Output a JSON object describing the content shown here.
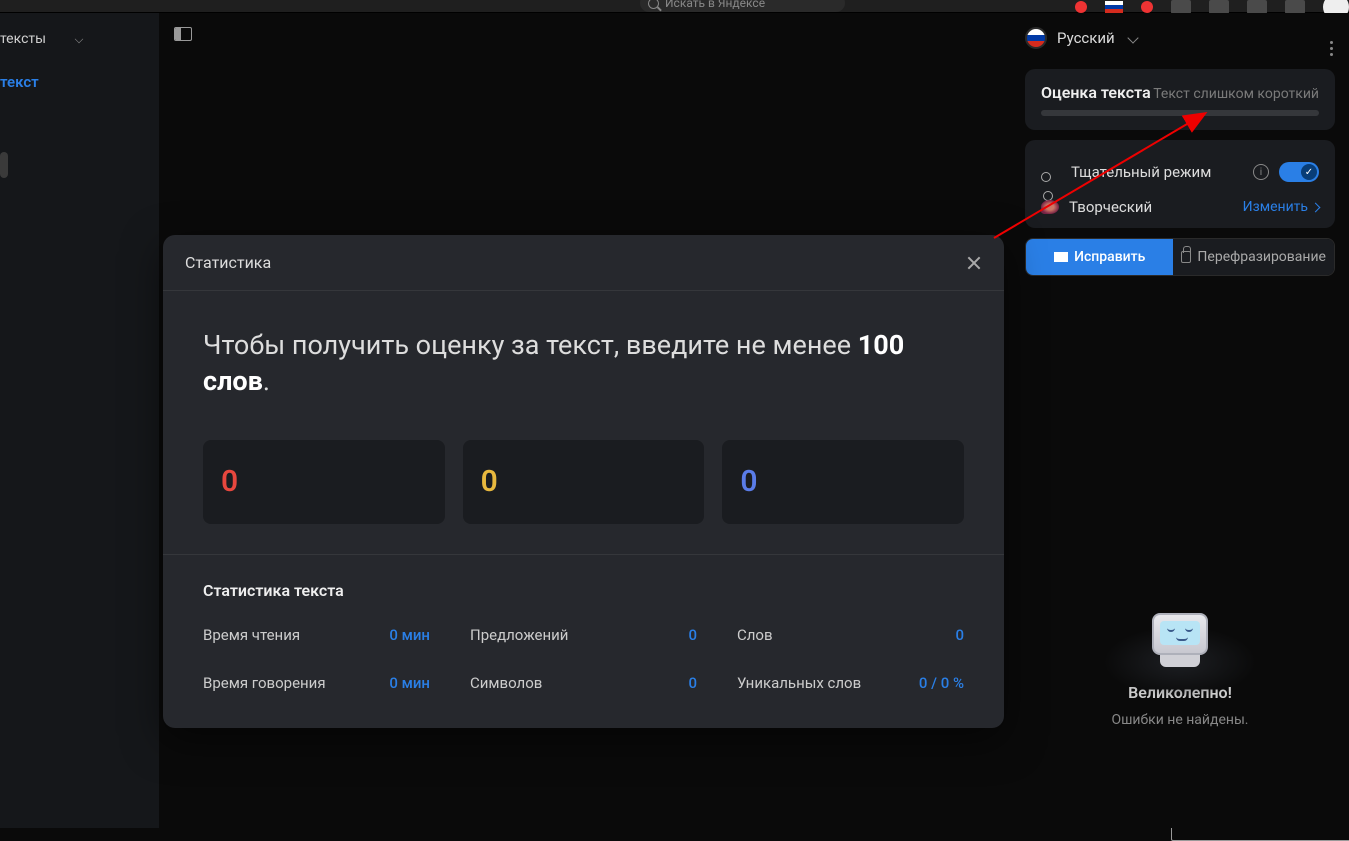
{
  "topbar": {
    "search_placeholder": "Искать в Яндексе"
  },
  "sidebar": {
    "header": "тексты",
    "item": "текст"
  },
  "right": {
    "language": "Русский",
    "score_title": "Оценка текста",
    "score_note": "Текст слишком короткий",
    "mode_label": "Тщательный режим",
    "creative_label": "Творческий",
    "change_label": "Изменить",
    "fix_button": "Исправить",
    "rephrase_button": "Перефразирование",
    "robot_title": "Великолепно!",
    "robot_sub": "Ошибки не найдены."
  },
  "modal": {
    "title": "Статистика",
    "message_prefix": "Чтобы получить оценку за текст, введите не менее ",
    "message_bold": "100 слов",
    "message_suffix": ".",
    "cards": {
      "red": "0",
      "yellow": "0",
      "blue": "0"
    },
    "footer_title": "Статистика текста",
    "stats": {
      "reading_label": "Время чтения",
      "reading_val": "0 мин",
      "sentences_label": "Предложений",
      "sentences_val": "0",
      "words_label": "Слов",
      "words_val": "0",
      "speaking_label": "Время говорения",
      "speaking_val": "0 мин",
      "chars_label": "Символов",
      "chars_val": "0",
      "unique_label": "Уникальных слов",
      "unique_val": "0 / 0 %"
    }
  }
}
